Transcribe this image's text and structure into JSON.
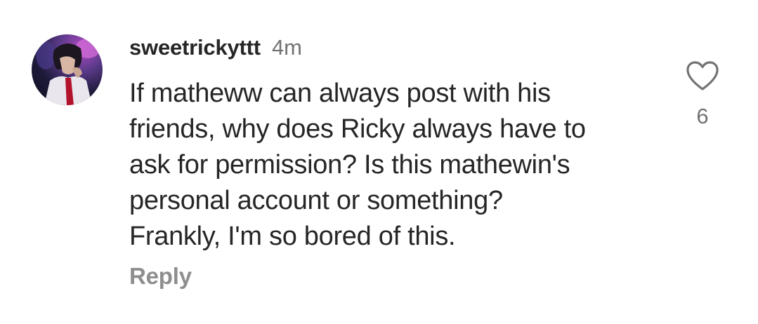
{
  "comment": {
    "username": "sweetrickyttt",
    "time": "4m",
    "lines": [
      "If matheww can always post with his",
      "friends, why does Ricky always have to",
      "ask for permission? Is this mathewin's",
      "personal account or something?",
      "Frankly, I'm so bored of this."
    ],
    "reply_label": "Reply",
    "like_count": "6",
    "like_icon": "heart-outline-icon"
  },
  "colors": {
    "text_primary": "#262626",
    "text_secondary": "#737373",
    "reply_text": "#8e8e8e",
    "background": "#ffffff"
  }
}
